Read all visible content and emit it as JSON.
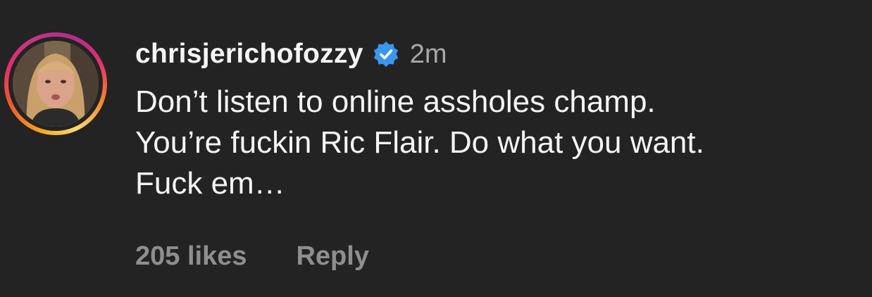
{
  "comment": {
    "username": "chrisjerichofozzy",
    "verified_icon": "verified-badge-icon",
    "timestamp": "2m",
    "lines": [
      "Don’t listen to online assholes champ.",
      "You’re fuckin Ric Flair. Do what you want.",
      "Fuck em…"
    ]
  },
  "footer": {
    "likes_label": "205 likes",
    "reply_label": "Reply"
  },
  "colors": {
    "background": "#232323",
    "text_primary": "#f5f5f5",
    "text_secondary": "#8e8e8e",
    "timestamp": "#a8a8a8",
    "verified_blue": "#3897f0"
  }
}
